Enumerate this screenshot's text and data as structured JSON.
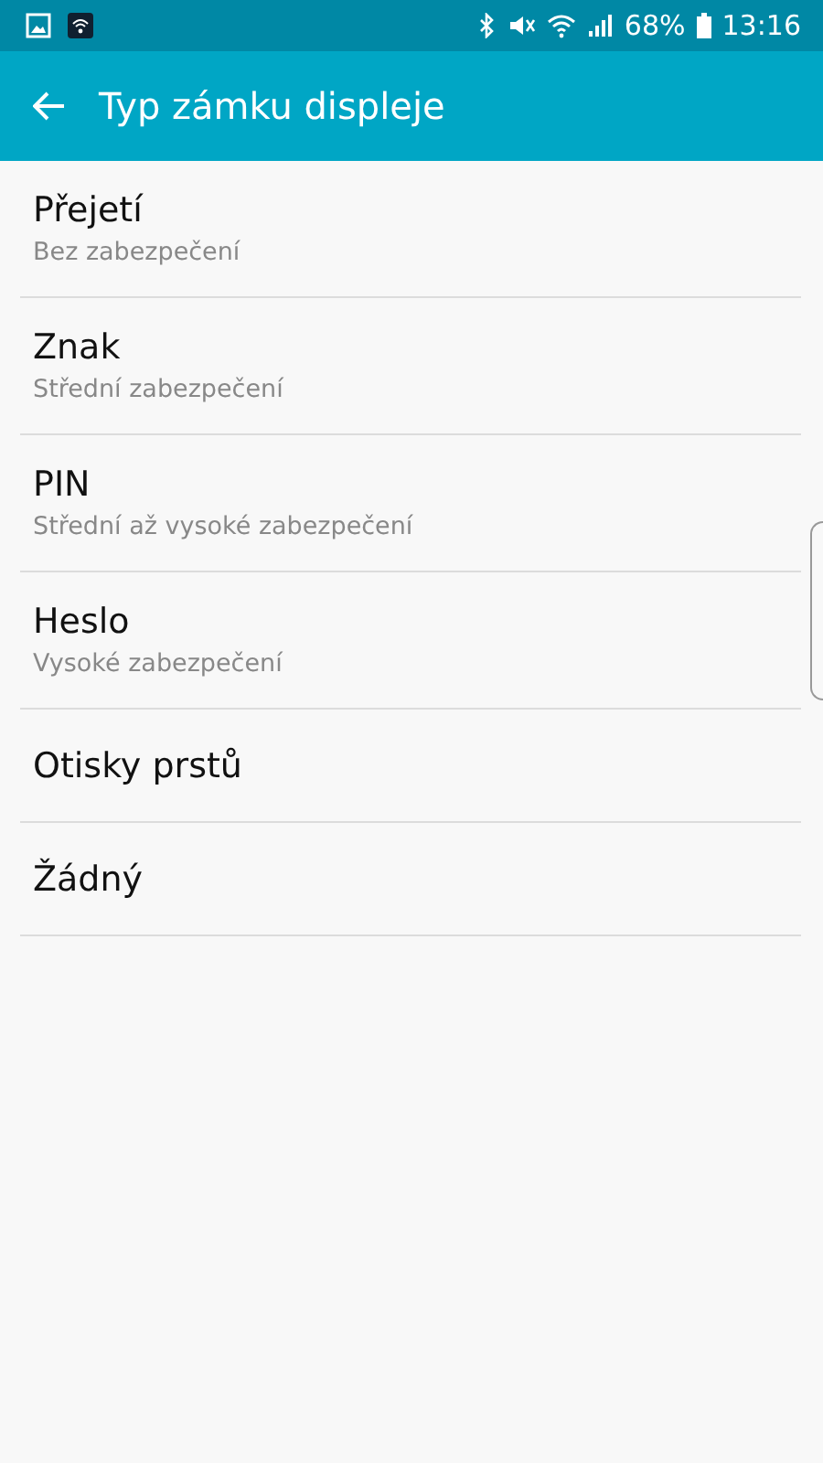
{
  "status_bar": {
    "battery": "68%",
    "time": "13:16"
  },
  "toolbar": {
    "title": "Typ zámku displeje"
  },
  "options": [
    {
      "title": "Přejetí",
      "subtitle": "Bez zabezpečení"
    },
    {
      "title": "Znak",
      "subtitle": "Střední zabezpečení"
    },
    {
      "title": "PIN",
      "subtitle": "Střední až vysoké zabezpečení"
    },
    {
      "title": "Heslo",
      "subtitle": "Vysoké zabezpečení"
    },
    {
      "title": "Otisky prstů"
    },
    {
      "title": "Žádný"
    }
  ]
}
